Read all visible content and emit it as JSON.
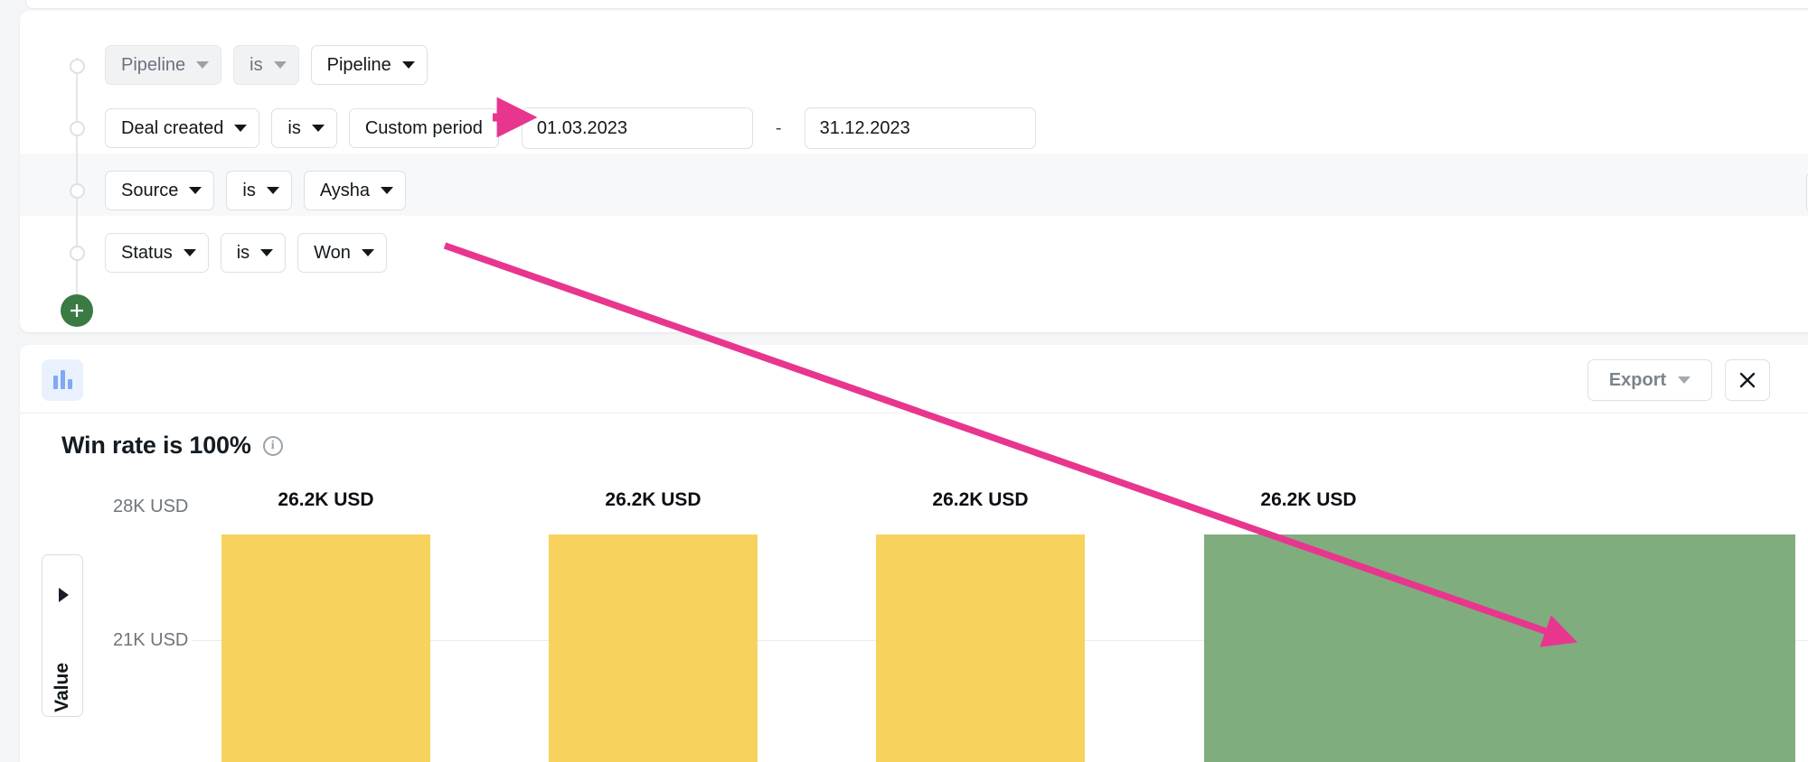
{
  "filters": {
    "rows": [
      {
        "field": {
          "label": "Pipeline",
          "disabled": true
        },
        "operator": {
          "label": "is",
          "disabled": true
        },
        "value": {
          "label": "Pipeline",
          "disabled": false
        }
      },
      {
        "field": {
          "label": "Deal created",
          "disabled": false
        },
        "operator": {
          "label": "is",
          "disabled": false
        },
        "value": {
          "label": "Custom period",
          "disabled": false
        },
        "date_from": "01.03.2023",
        "date_separator": "-",
        "date_to": "31.12.2023"
      },
      {
        "field": {
          "label": "Source",
          "disabled": false
        },
        "operator": {
          "label": "is",
          "disabled": false
        },
        "value": {
          "label": "Aysha",
          "disabled": false
        },
        "delete_icon": "trash-icon"
      },
      {
        "field": {
          "label": "Status",
          "disabled": false
        },
        "operator": {
          "label": "is",
          "disabled": false
        },
        "value": {
          "label": "Won",
          "disabled": false
        }
      }
    ],
    "add_condition_icon": "plus-icon",
    "accent_add_color": "#3B7A43"
  },
  "chart_panel": {
    "panel_icon": "bar-chart-icon",
    "export_label": "Export",
    "export_caret_icon": "chevron-down-icon",
    "close_icon": "close-icon",
    "title": "Win rate is 100%",
    "info_icon": "info-icon",
    "axis_toggle_icon": "play-triangle-icon",
    "axis_toggle_label": "Value"
  },
  "chart_data": {
    "type": "bar",
    "title": "Win rate is 100%",
    "xlabel": "",
    "ylabel": "Value",
    "categories": [
      "",
      "",
      "",
      ""
    ],
    "values": [
      26200,
      26200,
      26200,
      26200
    ],
    "data_labels": [
      "26.2K USD",
      "26.2K USD",
      "26.2K USD",
      "26.2K USD"
    ],
    "bar_colors": [
      "#F7D35E",
      "#F7D35E",
      "#F7D35E",
      "#7FAD7E"
    ],
    "ytick_labels": [
      "28K USD",
      "21K USD"
    ],
    "ytick_values": [
      28000,
      21000
    ],
    "ylim": [
      0,
      28000
    ],
    "grid": true,
    "legend": "none"
  },
  "annotations": {
    "arrow_color": "#E8368F",
    "arrow_1_target": "date_from_field",
    "arrow_2_target": "fourth_bar_label"
  }
}
